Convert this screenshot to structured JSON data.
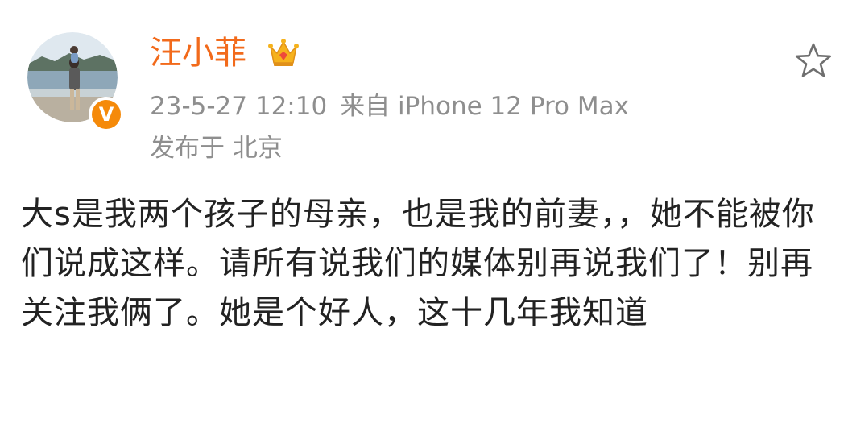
{
  "post": {
    "author": {
      "name": "汪小菲",
      "verified_badge": "V",
      "badge_icon": "crown-icon",
      "avatar_icon": "avatar-photo-icon"
    },
    "meta": {
      "timestamp": "23-5-27 12:10",
      "source": "来自 iPhone 12 Pro Max",
      "location": "发布于 北京"
    },
    "favorite_icon": "star-outline-icon",
    "text": "大s是我两个孩子的母亲，也是我的前妻，，她不能被你们说成这样。请所有说我们的媒体别再说我们了！别再关注我俩了。她是个好人，这十几年我知道"
  },
  "colors": {
    "username": "#f26a1b",
    "meta": "#8e8e8e",
    "body_text": "#222222",
    "verified": "#f58a0a"
  }
}
